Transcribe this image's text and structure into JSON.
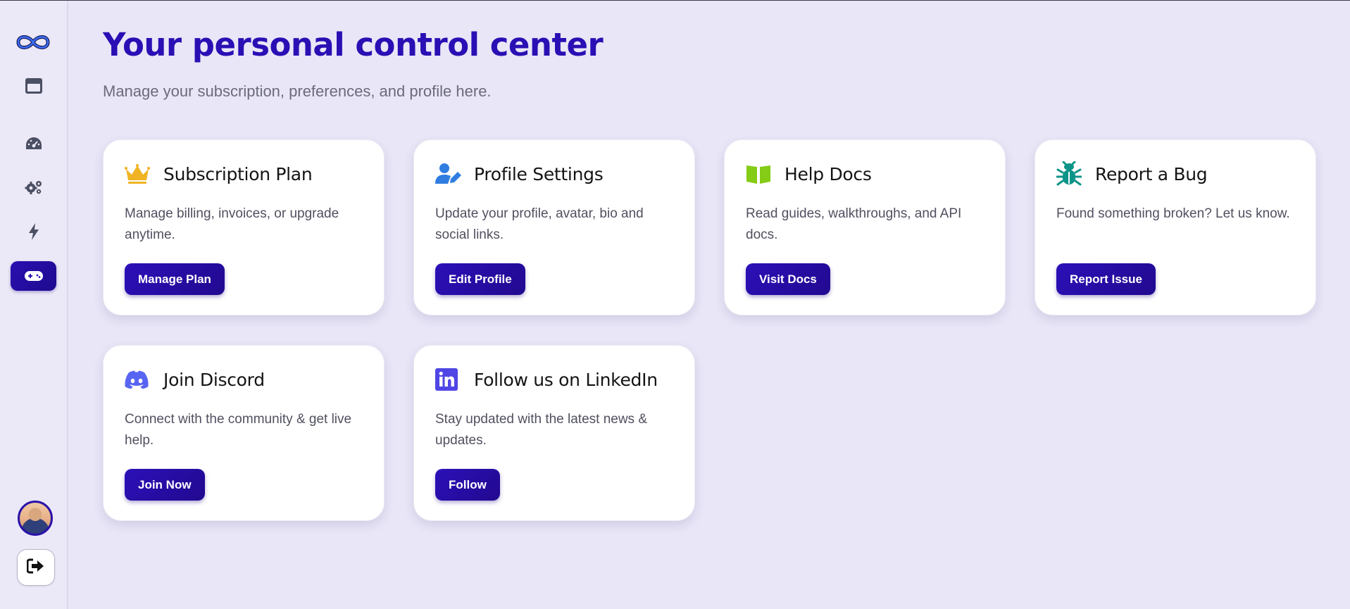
{
  "header": {
    "title": "Your personal control center",
    "subtitle": "Manage your subscription, preferences, and profile here."
  },
  "sidebar": {
    "items": [
      {
        "icon": "app-logo-icon"
      },
      {
        "icon": "window-icon"
      },
      {
        "icon": "dashboard-gauge-icon"
      },
      {
        "icon": "settings-gears-icon"
      },
      {
        "icon": "lightning-bolt-icon"
      },
      {
        "icon": "gamepad-icon",
        "active": true
      }
    ],
    "user": {
      "icon": "avatar"
    },
    "logout": {
      "icon": "logout-icon"
    }
  },
  "cards": [
    {
      "icon": "crown-icon",
      "icon_color": "#f0b323",
      "title": "Subscription Plan",
      "description": "Manage billing, invoices, or upgrade anytime.",
      "button": "Manage Plan"
    },
    {
      "icon": "user-edit-icon",
      "icon_color": "#2f7de1",
      "title": "Profile Settings",
      "description": "Update your profile, avatar, bio and social links.",
      "button": "Edit Profile"
    },
    {
      "icon": "open-book-icon",
      "icon_color": "#84cc16",
      "title": "Help Docs",
      "description": "Read guides, walkthroughs, and API docs.",
      "button": "Visit Docs"
    },
    {
      "icon": "bug-icon",
      "icon_color": "#0d9488",
      "title": "Report a Bug",
      "description": "Found something broken? Let us know.",
      "button": "Report Issue"
    },
    {
      "icon": "discord-icon",
      "icon_color": "#5865f2",
      "title": "Join Discord",
      "description": "Connect with the community & get live help.",
      "button": "Join Now"
    },
    {
      "icon": "linkedin-icon",
      "icon_color": "#4f46e5",
      "title": "Follow us on LinkedIn",
      "description": "Stay updated with the latest news & updates.",
      "button": "Follow"
    }
  ],
  "colors": {
    "accent": "#2a0fb4",
    "background": "#e9e6f7",
    "card": "#ffffff"
  }
}
